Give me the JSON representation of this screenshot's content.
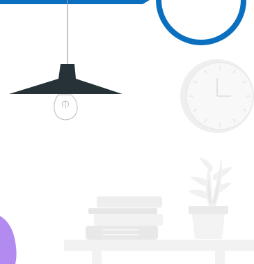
{
  "scene": {
    "background_color": "#ffffff",
    "elements": [
      {
        "name": "blue-banner-shape",
        "color": "#0A6FBF"
      },
      {
        "name": "blue-circle-outline",
        "color": "#0A6FBF"
      },
      {
        "name": "pendant-lamp",
        "shade_color": "#263238",
        "cord_color": "#9E9E9E"
      },
      {
        "name": "light-bulb-icon",
        "color": "#BDBDBD"
      },
      {
        "name": "wall-clock-icon",
        "face_color": "#F5F5F5",
        "hand_color": "#E0E0E0"
      },
      {
        "name": "potted-plant-icon",
        "color": "#EDEDED"
      },
      {
        "name": "book-stack-icon",
        "color": "#EBEBEB"
      },
      {
        "name": "shelf",
        "color": "#F0F0F0"
      },
      {
        "name": "purple-shape",
        "color": "#B38AF0"
      }
    ]
  }
}
